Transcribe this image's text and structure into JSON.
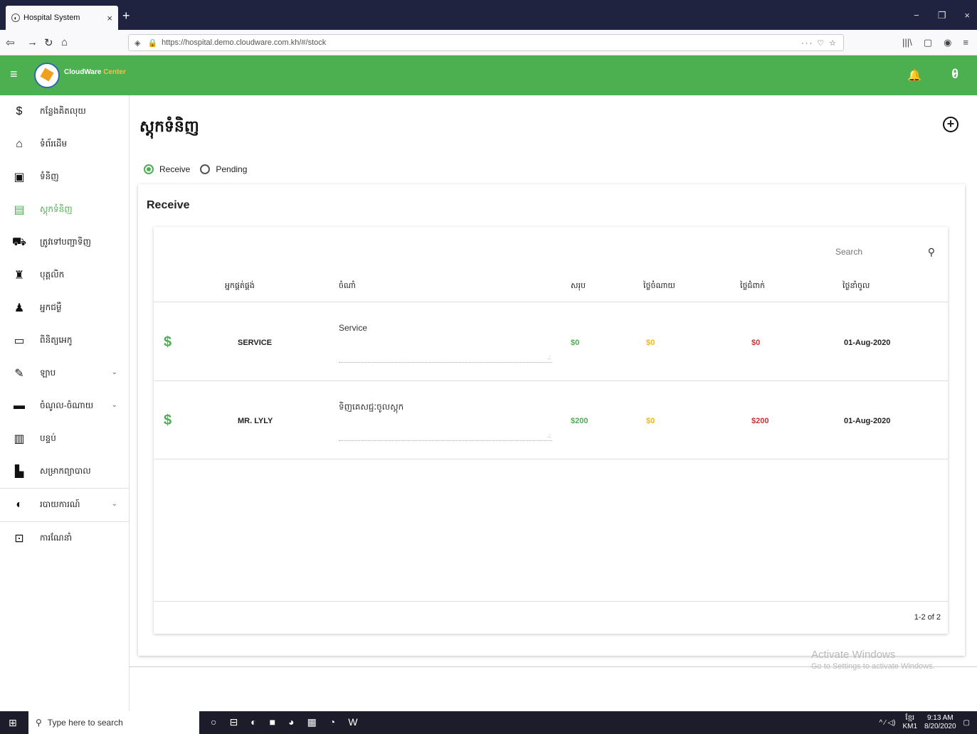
{
  "browser": {
    "tab_title": "Hospital System",
    "tab_close": "×",
    "new_tab": "+",
    "url": "https://hospital.demo.cloudware.com.kh/#/stock",
    "url_actions": "··· ♡ ☆",
    "window_controls": [
      "−",
      "❐",
      "×"
    ],
    "right_icons": [
      "|||\\",
      "▢",
      "◉",
      "≡"
    ]
  },
  "app": {
    "brand_main": "CloudWare",
    "brand_accent": "Center",
    "menu_icon": "≡",
    "bell_icon": "🔔",
    "account_icon": "θ",
    "account_caret": "▾"
  },
  "sidebar": {
    "items": [
      {
        "label": "កន្លែងគិតលុយ",
        "icon": "receipt-icon",
        "glyph": "$"
      },
      {
        "label": "ទំព័រដើម",
        "icon": "home-icon",
        "glyph": "⌂"
      },
      {
        "label": "ទំនិញ",
        "icon": "boxes-icon",
        "glyph": "▣"
      },
      {
        "label": "ស្តុកទំនិញ",
        "icon": "warehouse-icon",
        "glyph": "▤"
      },
      {
        "label": "ត្រូវទៅបញ្ជាទិញ",
        "icon": "cart-icon",
        "glyph": "⛟"
      },
      {
        "label": "បុគ្គលិក",
        "icon": "staff-icon",
        "glyph": "♜"
      },
      {
        "label": "អ្នកជម្ងឺ",
        "icon": "patient-icon",
        "glyph": "♟"
      },
      {
        "label": "ពិនិត្យអេកូ",
        "icon": "monitor-icon",
        "glyph": "▭"
      },
      {
        "label": "ឡាប",
        "icon": "lab-icon",
        "glyph": "✎"
      },
      {
        "label": "ចំណូល-ចំណាយ",
        "icon": "finance-icon",
        "glyph": "▬"
      },
      {
        "label": "បន្ទប់",
        "icon": "room-icon",
        "glyph": "▥"
      },
      {
        "label": "សម្រាកព្យាបាល",
        "icon": "bed-icon",
        "glyph": "▙"
      },
      {
        "label": "របាយការណ៍",
        "icon": "report-icon",
        "glyph": "◐"
      },
      {
        "label": "ការណែនាំ",
        "icon": "guide-icon",
        "glyph": "⊡"
      }
    ],
    "chevron": "⌄"
  },
  "page": {
    "title": "ស្តុកទំនិញ",
    "add_icon": "+",
    "radio_receive": "Receive",
    "radio_pending": "Pending",
    "card_title": "Receive",
    "search_placeholder": "Search",
    "search_icon": "⚲",
    "columns": [
      "អ្នកផ្គត់ផ្គង់",
      "ចំណាំ",
      "សរុប",
      "ថ្លៃចំណាយ",
      "ថ្លៃជំពាក់",
      "ថ្ងៃនាំចូល"
    ],
    "row_icon": "$",
    "resize_grip": ".:",
    "rows": [
      {
        "supplier": "SERVICE",
        "note": "Service",
        "total": "$0",
        "expense": "$0",
        "owed": "$0",
        "date": "01-Aug-2020"
      },
      {
        "supplier": "MR. LYLY",
        "note": "ទិញគេសជ្ជៈចូលស្តុក",
        "total": "$200",
        "expense": "$0",
        "owed": "$200",
        "date": "01-Aug-2020"
      }
    ],
    "pagination": "1-2 of 2"
  },
  "watermark": {
    "line1": "Activate Windows",
    "line2": "Go to Settings to activate Windows."
  },
  "taskbar": {
    "start_icon": "⊞",
    "search_icon": "⚲",
    "search_placeholder": "Type here to search",
    "apps": [
      "○",
      "⊟",
      "◐",
      "■",
      "◕",
      "▦",
      "◔",
      "W"
    ],
    "tray_icons": "^ ⁄ ◁)",
    "lang": "ខ្មែរ",
    "lang_code": "KM1",
    "time": "9:13 AM",
    "date": "8/20/2020",
    "notify_icon": "▢"
  },
  "colors": {
    "green": "#4caf50",
    "yellow": "#f5b31a",
    "red": "#d32f2f"
  }
}
